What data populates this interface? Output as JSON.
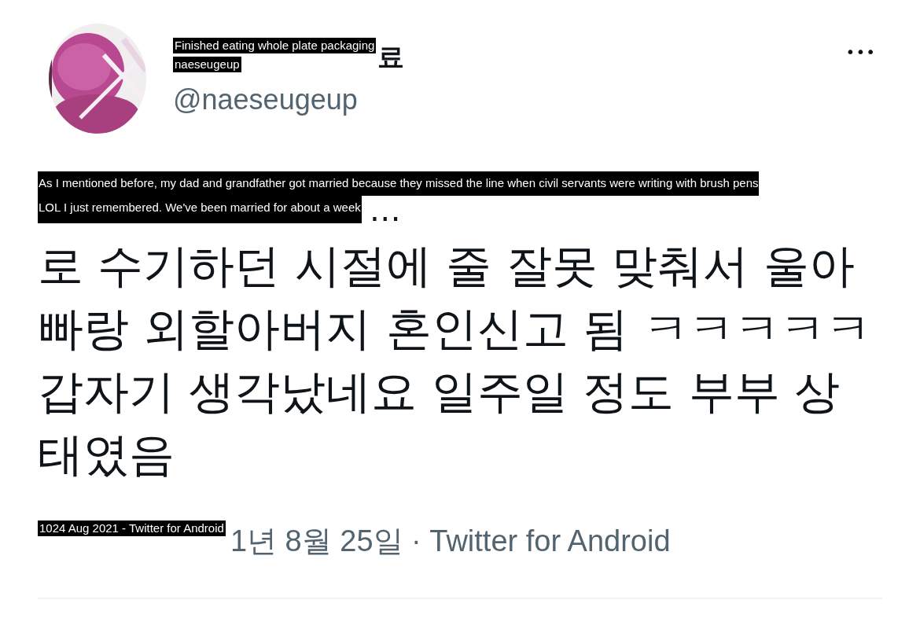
{
  "author": {
    "name": "료",
    "handle": "@naeseugeup",
    "name_overlay": [
      "Finished eating whole plate packaging",
      "naeseugeup"
    ]
  },
  "more_menu": "•••",
  "tweet": {
    "overlay": [
      "As I mentioned before, my dad and grandfather got married because they missed the line when civil servants were writing with brush pens",
      "LOL I just remembered. We've been married for about a week"
    ],
    "lead": "…",
    "text": "로 수기하던 시절에 줄 잘못 맞춰서 울아빠랑 외할아버지 혼인신고 됨 ㅋㅋㅋㅋㅋ 갑자기 생각났네요 일주일 정도 부부 상태였음"
  },
  "meta": {
    "overlay": [
      "1024 Aug 2021 - Twitter for Android"
    ],
    "text": "1년 8월 25일 · Twitter for Android"
  }
}
